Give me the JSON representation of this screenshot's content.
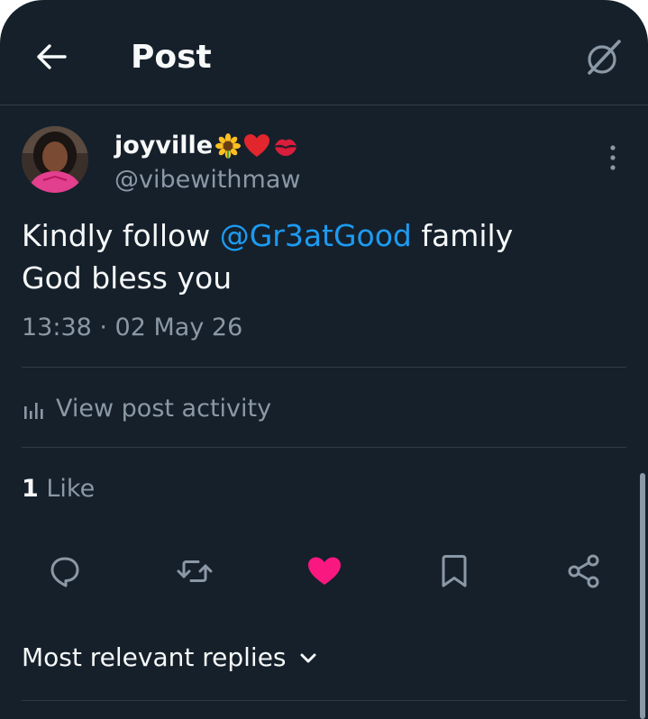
{
  "header": {
    "title": "Post",
    "back_icon": "arrow-left-icon",
    "grok_icon": "grok-icon"
  },
  "author": {
    "display_name": "joyville",
    "emojis": [
      "sunflower-emoji",
      "red-heart-emoji",
      "kiss-mark-emoji"
    ],
    "handle": "@vibewithmaw",
    "more_icon": "more-vertical-icon"
  },
  "post": {
    "line1_pre": "Kindly follow ",
    "mention": "@Gr3atGood",
    "line1_post": " family",
    "line2": "God bless you",
    "timestamp": "13:38 · 02 May 26"
  },
  "activity": {
    "label": "View post activity",
    "icon": "bar-chart-icon"
  },
  "likes": {
    "count": "1",
    "label": "Like"
  },
  "actions": [
    {
      "name": "reply",
      "icon": "reply-icon"
    },
    {
      "name": "repost",
      "icon": "repost-icon"
    },
    {
      "name": "like",
      "icon": "heart-icon",
      "active": true
    },
    {
      "name": "bookmark",
      "icon": "bookmark-icon"
    },
    {
      "name": "share",
      "icon": "share-icon"
    }
  ],
  "replies": {
    "label": "Most relevant replies",
    "icon": "chevron-down-icon"
  },
  "colors": {
    "background": "#15202b",
    "text": "#f7f9f9",
    "secondary_text": "#8b98a5",
    "link": "#1d9bf0",
    "like_active": "#f91880",
    "divider": "#2f3b47"
  }
}
